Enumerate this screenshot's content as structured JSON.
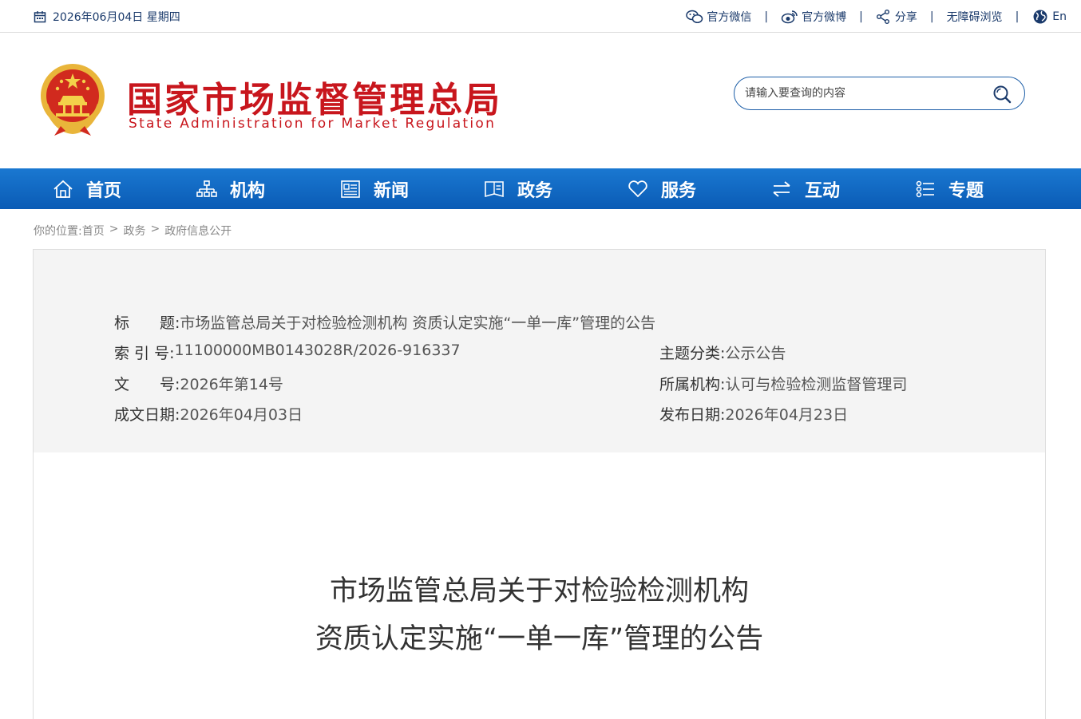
{
  "topbar": {
    "date": "2026年06月04日 星期四",
    "links": [
      "官方微信",
      "官方微博",
      "分享",
      "无障碍浏览",
      "En"
    ]
  },
  "header": {
    "title_cn": "国家市场监督管理总局",
    "title_en": "State Administration for Market Regulation",
    "search_placeholder": "请输入要查询的内容"
  },
  "nav": {
    "items": [
      "首页",
      "机构",
      "新闻",
      "政务",
      "服务",
      "互动",
      "专题"
    ]
  },
  "breadcrumb": {
    "prefix": "你的位置:",
    "items": [
      "首页",
      "政务",
      "政府信息公开"
    ],
    "separator": ">"
  },
  "info": {
    "title_label": "标　　题:",
    "title_value": "市场监管总局关于对检验检测机构 资质认定实施“一单一库”管理的公告",
    "index_label": "索 引 号:",
    "index_value": "11100000MB0143028R/2026-916337",
    "topic_label": "主题分类:",
    "topic_value": "公示公告",
    "docno_label": "文　　号:",
    "docno_value": "2026年第14号",
    "org_label": "所属机构:",
    "org_value": "认可与检验检测监督管理司",
    "written_label": "成文日期:",
    "written_value": "2026年04月03日",
    "publish_label": "发布日期:",
    "publish_value": "2026年04月23日"
  },
  "document": {
    "title_line1": "市场监管总局关于对检验检测机构",
    "title_line2": "资质认定实施“一单一库”管理的公告"
  },
  "colors": {
    "brand_red": "#c8161d",
    "nav_blue": "#0a5bb5",
    "link_navy": "#1a3a6b"
  }
}
